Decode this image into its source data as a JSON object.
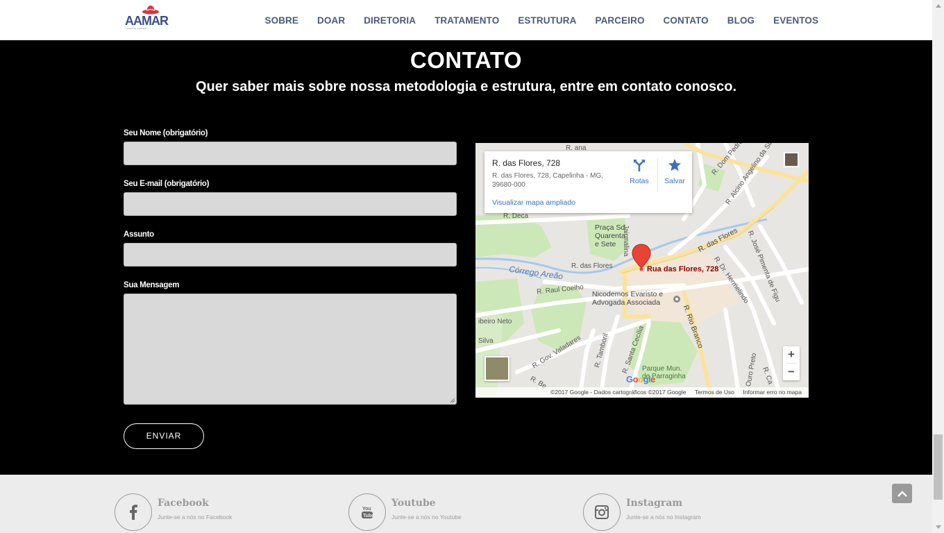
{
  "header": {
    "logo_text": "AAMAR",
    "logo_sub": "unidade de tratamento",
    "nav": [
      "SOBRE",
      "DOAR",
      "DIRETORIA",
      "TRATAMENTO",
      "ESTRUTURA",
      "PARCEIRO",
      "CONTATO",
      "BLOG",
      "EVENTOS"
    ]
  },
  "contact": {
    "title": "CONTATO",
    "subtitle": "Quer saber mais sobre nossa metodologia e estrutura,  entre em contato conosco.",
    "fields": {
      "name_label": "Seu Nome (obrigatório)",
      "email_label": "Seu E-mail (obrigatório)",
      "subject_label": "Assunto",
      "message_label": "Sua Mensagem"
    },
    "submit_label": "ENVIAR"
  },
  "map": {
    "card": {
      "title": "R. das Flores, 728",
      "address": "R. das Flores, 728, Capelinha - MG, 39680-000",
      "directions": "Rotas",
      "save": "Salvar",
      "enlarge_link": "Visualizar mapa ampliado"
    },
    "pin_label": "Rua das Flores, 728",
    "labels": {
      "dom_pedro": "R. Dom Pedro II",
      "alcino": "R. Alcino Angelino da Sil",
      "deca": "R. Deca",
      "praca": "Praça Sd\nQuarenta\ne Sete",
      "almeida": "Jairmalina",
      "flores_ne": "R. das Flores",
      "flores_w": "R. das Flores",
      "jose_pimenta": "R. José Pimenta de Figu",
      "hermelindo": "R. Dr. Hermelindo",
      "corrego": "Córrego Areão",
      "raul_coelho": "R. Raul Coelho",
      "nicodemos": "Nicodemos Evaristo e\nAdvogada Associada",
      "rio_branco": "R. Rio Branco",
      "ribeiro_neto": "ibeiro Neto",
      "silva": "Silva",
      "gov_valadares": "R. Gov. Valadares",
      "tamboril": "R. Tamboril",
      "santa_cecilia": "R. Santa Cecília",
      "parque": "Parque Mun.\nde Parraginha",
      "ouro_preto": "Ouro Preto",
      "r_be": "R. Be",
      "r_ca": "R. Ca",
      "r_ana": "R. ana"
    },
    "zoom_in": "+",
    "zoom_out": "−",
    "google": "Google",
    "attribution": "©2017 Google - Dados cartográficos ©2017 Google",
    "terms": "Termos de Uso",
    "report": "Informar erro no mapa"
  },
  "footer": {
    "social": [
      {
        "name": "Facebook",
        "sub": "Junte-se a nós no Facebook",
        "icon": "facebook-icon"
      },
      {
        "name": "Youtube",
        "sub": "Junte-se a nós no Youtube",
        "icon": "youtube-icon"
      },
      {
        "name": "Instagram",
        "sub": "Junte-se a nós no Instagram",
        "icon": "instagram-icon"
      }
    ]
  },
  "colors": {
    "nav_text": "#4b5a78",
    "background": "#000000",
    "input_bg": "#d9d9d9",
    "footer_bg": "#ececec",
    "map_link": "#3a6fc4",
    "pin": "#ea4335"
  }
}
